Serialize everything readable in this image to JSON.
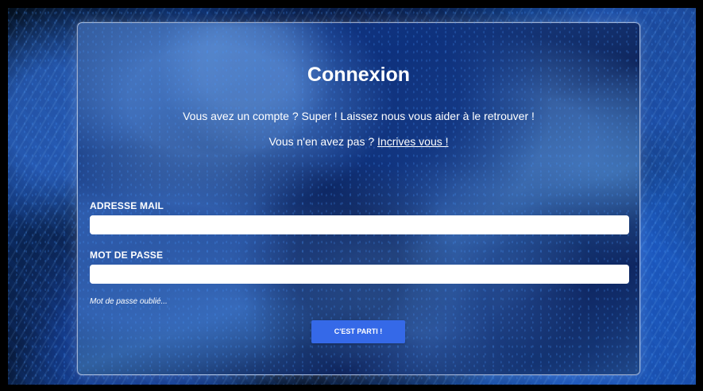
{
  "login": {
    "title": "Connexion",
    "intro": "Vous avez un compte ? Super ! Laissez nous vous aider à le retrouver !",
    "signup_prefix": "Vous n'en avez pas ? ",
    "signup_link": "Incrives vous !",
    "email_label": "ADRESSE MAIL",
    "email_value": "",
    "password_label": "MOT DE PASSE",
    "password_value": "",
    "forgot_password": "Mot de passe oublié...",
    "submit_label": "C'EST PARTI !"
  },
  "colors": {
    "button": "#3569e8",
    "text": "#ffffff",
    "background_primary": "#0f275e"
  }
}
